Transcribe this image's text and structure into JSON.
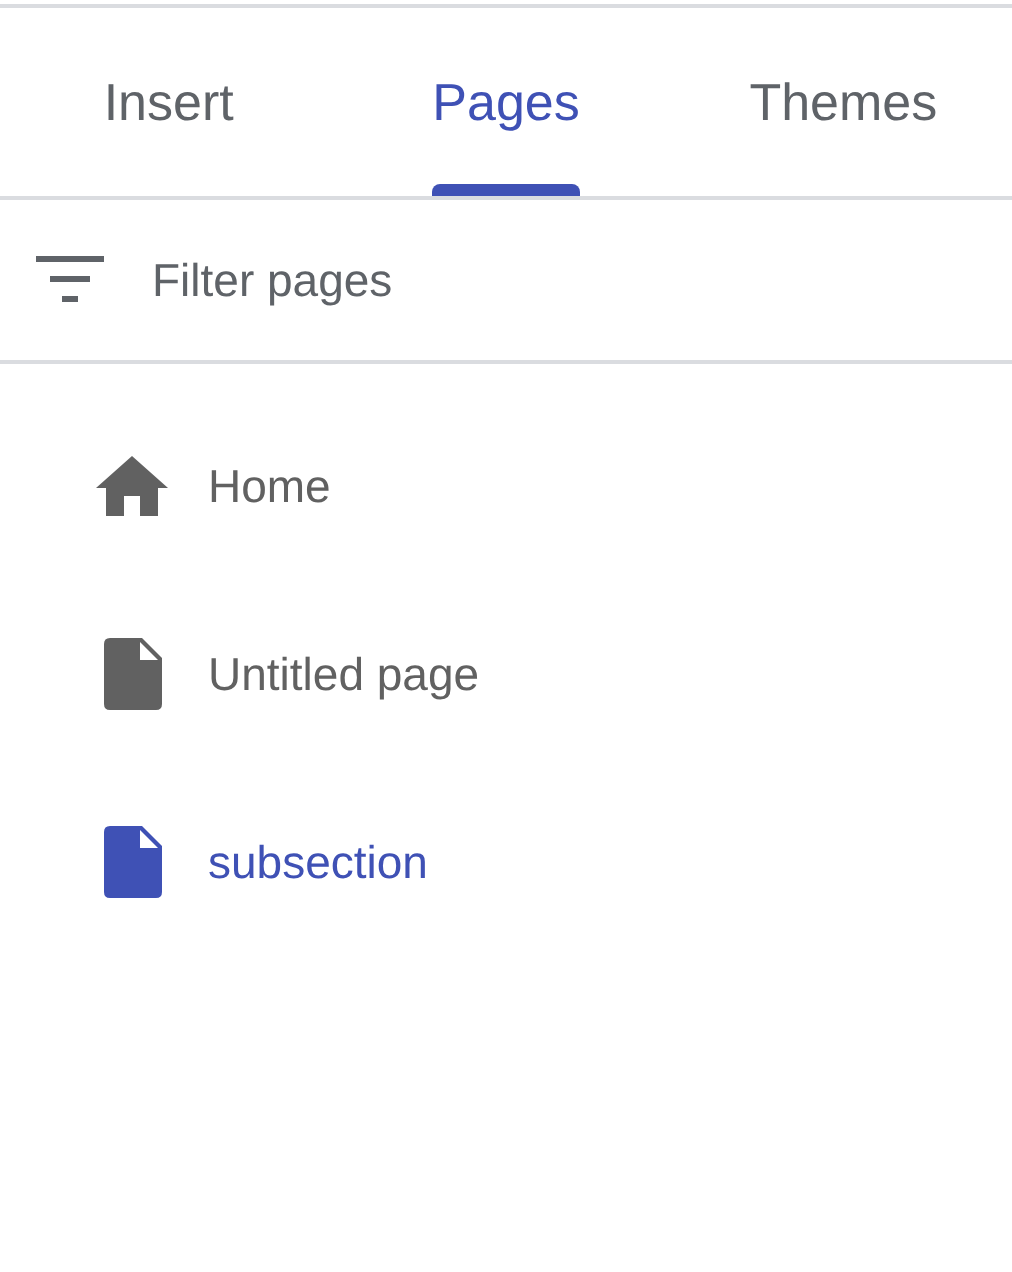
{
  "tabs": [
    {
      "label": "Insert",
      "selected": false
    },
    {
      "label": "Pages",
      "selected": true
    },
    {
      "label": "Themes",
      "selected": false
    }
  ],
  "filter": {
    "placeholder": "Filter pages"
  },
  "pages": [
    {
      "label": "Home",
      "kind": "home",
      "selected": false
    },
    {
      "label": "Untitled page",
      "kind": "page",
      "selected": false
    },
    {
      "label": "subsection",
      "kind": "page",
      "selected": true
    }
  ]
}
